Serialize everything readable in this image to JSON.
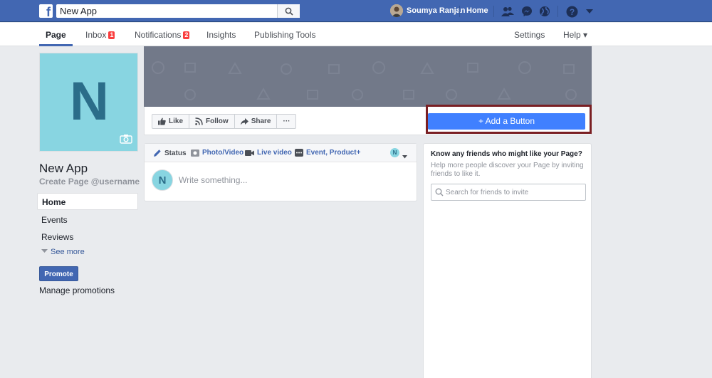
{
  "topbar": {
    "logo": "f",
    "search_value": "New App",
    "user_name": "Soumya Ranjan",
    "home_label": "Home",
    "icons": [
      "friends-icon",
      "messenger-icon",
      "globe-icon",
      "help-icon",
      "dropdown-arrow-icon"
    ]
  },
  "pagenav": {
    "tabs": [
      {
        "label": "Page",
        "badge": ""
      },
      {
        "label": "Inbox",
        "badge": "1"
      },
      {
        "label": "Notifications",
        "badge": "2"
      },
      {
        "label": "Insights",
        "badge": ""
      },
      {
        "label": "Publishing Tools",
        "badge": ""
      }
    ],
    "settings": "Settings",
    "help": "Help ▾"
  },
  "sidebar": {
    "profile_letter": "N",
    "page_name": "New App",
    "username_prompt": "Create Page @username",
    "items": [
      {
        "label": "Home"
      },
      {
        "label": "Events"
      },
      {
        "label": "Reviews"
      }
    ],
    "see_more": "See more",
    "promote": "Promote",
    "manage_promotions": "Manage promotions"
  },
  "actions": {
    "like": "Like",
    "follow": "Follow",
    "share": "Share",
    "more": "···",
    "add_button": "+ Add a Button"
  },
  "composer": {
    "tabs": [
      {
        "label": "Status"
      },
      {
        "label": "Photo/Video"
      },
      {
        "label": "Live video"
      },
      {
        "label": "Event, Product+"
      }
    ],
    "avatar_letter": "N",
    "placeholder": "Write something..."
  },
  "friends": {
    "title": "Know any friends who might like your Page?",
    "description": "Help more people discover your Page by inviting friends to like it.",
    "search_placeholder": "Search for friends to invite"
  },
  "colors": {
    "brand": "#4267b2",
    "button_blue": "#4080ff",
    "highlight": "#7a1f23",
    "cover": "#727989",
    "avatar_bg": "#88d5e1",
    "avatar_fg": "#2b6d89"
  }
}
